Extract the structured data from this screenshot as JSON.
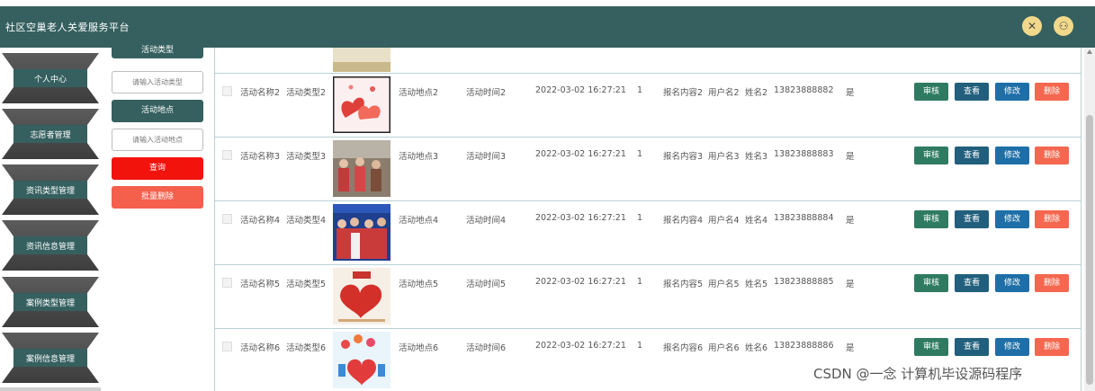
{
  "app": {
    "title": "社区空巢老人关爱服务平台",
    "icon_left": "✕",
    "icon_right": "⚇"
  },
  "sidebar": {
    "items": [
      {
        "label": "个人中心"
      },
      {
        "label": "志愿者管理"
      },
      {
        "label": "资讯类型管理"
      },
      {
        "label": "资讯信息管理"
      },
      {
        "label": "案例类型管理"
      },
      {
        "label": "案例信息管理"
      }
    ]
  },
  "filter": {
    "type_label": "活动类型",
    "type_placeholder": "请输入活动类型",
    "place_label": "活动地点",
    "place_placeholder": "请输入活动地点",
    "query_label": "查询",
    "batch_delete_label": "批量删除"
  },
  "actions": {
    "review": "审核",
    "view": "查看",
    "edit": "修改",
    "delete": "删除"
  },
  "rows": [
    {
      "name": "活动名称2",
      "type": "活动类型2",
      "place": "活动地点2",
      "time": "活动时间2",
      "datetime": "2022-03-02 16:27:21",
      "count": "1",
      "content": "报名内容2",
      "user": "用户名2",
      "realname": "姓名2",
      "phone": "13823888882",
      "status": "是"
    },
    {
      "name": "活动名称3",
      "type": "活动类型3",
      "place": "活动地点3",
      "time": "活动时间3",
      "datetime": "2022-03-02 16:27:21",
      "count": "1",
      "content": "报名内容3",
      "user": "用户名3",
      "realname": "姓名3",
      "phone": "13823888883",
      "status": "是"
    },
    {
      "name": "活动名称4",
      "type": "活动类型4",
      "place": "活动地点4",
      "time": "活动时间4",
      "datetime": "2022-03-02 16:27:21",
      "count": "1",
      "content": "报名内容4",
      "user": "用户名4",
      "realname": "姓名4",
      "phone": "13823888884",
      "status": "是"
    },
    {
      "name": "活动名称5",
      "type": "活动类型5",
      "place": "活动地点5",
      "time": "活动时间5",
      "datetime": "2022-03-02 16:27:21",
      "count": "1",
      "content": "报名内容5",
      "user": "用户名5",
      "realname": "姓名5",
      "phone": "13823888885",
      "status": "是"
    },
    {
      "name": "活动名称6",
      "type": "活动类型6",
      "place": "活动地点6",
      "time": "活动时间6",
      "datetime": "2022-03-02 16:27:21",
      "count": "1",
      "content": "报名内容6",
      "user": "用户名6",
      "realname": "姓名6",
      "phone": "13823888886",
      "status": "是"
    }
  ],
  "watermark": "CSDN @一念 计算机毕设源码程序",
  "colors": {
    "header": "#35605f",
    "review": "#2f7b62",
    "view": "#215f7d",
    "edit": "#1e6fa8",
    "delete": "#f5674f",
    "query": "#f2130d",
    "batch_delete": "#f4604c"
  }
}
